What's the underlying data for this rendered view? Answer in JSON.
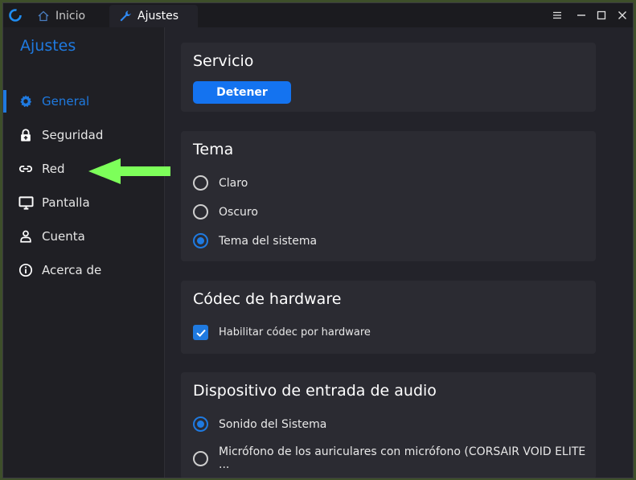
{
  "window": {
    "tabs": [
      {
        "label": "Inicio",
        "icon": "home-icon"
      },
      {
        "label": "Ajustes",
        "icon": "wrench-icon"
      }
    ],
    "controls": [
      "menu-icon",
      "minimize-icon",
      "maximize-icon",
      "close-icon"
    ]
  },
  "sidebar": {
    "title": "Ajustes",
    "items": [
      {
        "label": "General",
        "icon": "gear-icon",
        "active": true
      },
      {
        "label": "Seguridad",
        "icon": "lock-icon"
      },
      {
        "label": "Red",
        "icon": "link-icon"
      },
      {
        "label": "Pantalla",
        "icon": "monitor-icon"
      },
      {
        "label": "Cuenta",
        "icon": "user-icon"
      },
      {
        "label": "Acerca de",
        "icon": "info-icon"
      }
    ]
  },
  "service": {
    "title": "Servicio",
    "button": "Detener"
  },
  "theme": {
    "title": "Tema",
    "options": [
      {
        "label": "Claro",
        "selected": false
      },
      {
        "label": "Oscuro",
        "selected": false
      },
      {
        "label": "Tema del sistema",
        "selected": true
      }
    ]
  },
  "codec": {
    "title": "Códec de hardware",
    "checkbox_label": "Habilitar códec por hardware",
    "checked": true
  },
  "audio": {
    "title": "Dispositivo de entrada de audio",
    "options": [
      {
        "label": "Sonido del Sistema",
        "selected": true
      },
      {
        "label": "Micrófono de los auriculares con micrófono (CORSAIR VOID ELITE ...",
        "selected": false
      }
    ]
  },
  "colors": {
    "accent": "#1f7ae0",
    "button": "#1473f0",
    "annotation_arrow": "#7dff5a"
  }
}
